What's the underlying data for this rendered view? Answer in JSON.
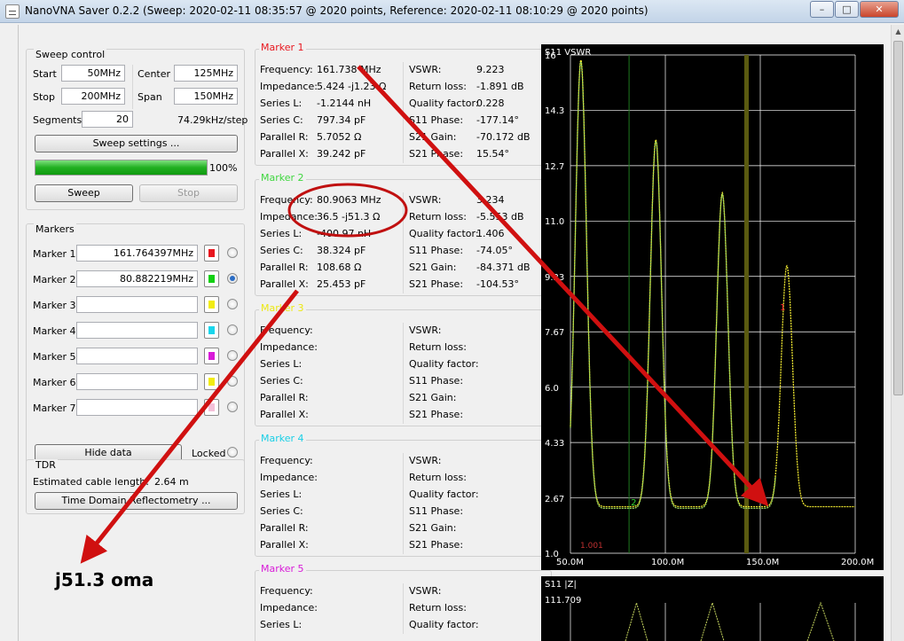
{
  "window": {
    "title": "NanoVNA Saver 0.2.2 (Sweep: 2020-02-11 08:35:57 @ 2020 points, Reference: 2020-02-11 08:10:29 @ 2020 points)",
    "minimize_glyph": "–",
    "maximize_glyph": "□",
    "close_glyph": "✕"
  },
  "sweep_control": {
    "title": "Sweep control",
    "start_label": "Start",
    "start_value": "50MHz",
    "center_label": "Center",
    "center_value": "125MHz",
    "stop_label": "Stop",
    "stop_value": "200MHz",
    "span_label": "Span",
    "span_value": "150MHz",
    "segments_label": "Segments",
    "segments_value": "20",
    "step": "74.29kHz/step",
    "settings_button": "Sweep settings ...",
    "progress": 1.0,
    "progress_text": "100%",
    "sweep_button": "Sweep",
    "stop_button": "Stop"
  },
  "markers_panel": {
    "title": "Markers",
    "items": [
      {
        "label": "Marker 1",
        "value": "161.764397MHz",
        "color": "#e8161e",
        "selected": false
      },
      {
        "label": "Marker 2",
        "value": "80.882219MHz",
        "color": "#12d012",
        "selected": true
      },
      {
        "label": "Marker 3",
        "value": "",
        "color": "#f2ec12",
        "selected": false
      },
      {
        "label": "Marker 4",
        "value": "",
        "color": "#1ad6ec",
        "selected": false
      },
      {
        "label": "Marker 5",
        "value": "",
        "color": "#d81ad8",
        "selected": false
      },
      {
        "label": "Marker 6",
        "value": "",
        "color": "#f2ec12",
        "selected": false
      },
      {
        "label": "Marker 7",
        "value": "",
        "color": "#f4c0d8",
        "selected": false
      }
    ],
    "hide_button": "Hide data",
    "locked_label": "Locked"
  },
  "tdr": {
    "title": "TDR",
    "cable_length_label": "Estimated cable length:",
    "cable_length_value": "2.64 m",
    "button": "Time Domain Reflectometry ..."
  },
  "marker_info": [
    {
      "title": "Marker 1",
      "color": "#e8161e",
      "left": [
        [
          "Frequency:",
          "161.738 MHz"
        ],
        [
          "Impedance:",
          "5.424 -j1.23 Ω"
        ],
        [
          "Series L:",
          "-1.2144 nH"
        ],
        [
          "Series C:",
          "797.34 pF"
        ],
        [
          "Parallel R:",
          "5.7052 Ω"
        ],
        [
          "Parallel X:",
          "39.242 pF"
        ]
      ],
      "right": [
        [
          "VSWR:",
          "9.223"
        ],
        [
          "Return loss:",
          "-1.891 dB"
        ],
        [
          "Quality factor:",
          "0.228"
        ],
        [
          "S11 Phase:",
          "-177.14°"
        ],
        [
          "S21 Gain:",
          "-70.172 dB"
        ],
        [
          "S21 Phase:",
          "15.54°"
        ]
      ]
    },
    {
      "title": "Marker 2",
      "color": "#3ed63e",
      "left": [
        [
          "Frequency:",
          "80.9063 MHz"
        ],
        [
          "Impedance:",
          "36.5 -j51.3 Ω"
        ],
        [
          "Series L:",
          "-400.97 nH"
        ],
        [
          "Series C:",
          "38.324 pF"
        ],
        [
          "Parallel R:",
          "108.68 Ω"
        ],
        [
          "Parallel X:",
          "25.453 pF"
        ]
      ],
      "right": [
        [
          "VSWR:",
          "3.234"
        ],
        [
          "Return loss:",
          "-5.553 dB"
        ],
        [
          "Quality factor:",
          "1.406"
        ],
        [
          "S11 Phase:",
          "-74.05°"
        ],
        [
          "S21 Gain:",
          "-84.371 dB"
        ],
        [
          "S21 Phase:",
          "-104.53°"
        ]
      ]
    },
    {
      "title": "Marker 3",
      "color": "#ece812",
      "left": [
        [
          "Frequency:",
          ""
        ],
        [
          "Impedance:",
          ""
        ],
        [
          "Series L:",
          ""
        ],
        [
          "Series C:",
          ""
        ],
        [
          "Parallel R:",
          ""
        ],
        [
          "Parallel X:",
          ""
        ]
      ],
      "right": [
        [
          "VSWR:",
          ""
        ],
        [
          "Return loss:",
          ""
        ],
        [
          "Quality factor:",
          ""
        ],
        [
          "S11 Phase:",
          ""
        ],
        [
          "S21 Gain:",
          ""
        ],
        [
          "S21 Phase:",
          ""
        ]
      ]
    },
    {
      "title": "Marker 4",
      "color": "#19cfe6",
      "left": [
        [
          "Frequency:",
          ""
        ],
        [
          "Impedance:",
          ""
        ],
        [
          "Series L:",
          ""
        ],
        [
          "Series C:",
          ""
        ],
        [
          "Parallel R:",
          ""
        ],
        [
          "Parallel X:",
          ""
        ]
      ],
      "right": [
        [
          "VSWR:",
          ""
        ],
        [
          "Return loss:",
          ""
        ],
        [
          "Quality factor:",
          ""
        ],
        [
          "S11 Phase:",
          ""
        ],
        [
          "S21 Gain:",
          ""
        ],
        [
          "S21 Phase:",
          ""
        ]
      ]
    },
    {
      "title": "Marker 5",
      "color": "#d81ad8",
      "left": [
        [
          "Frequency:",
          ""
        ],
        [
          "Impedance:",
          ""
        ],
        [
          "Series L:",
          ""
        ]
      ],
      "right": [
        [
          "VSWR:",
          ""
        ],
        [
          "Return loss:",
          ""
        ],
        [
          "Quality factor:",
          ""
        ]
      ]
    }
  ],
  "vswr_chart": {
    "title": "S11 VSWR",
    "y_ticks": [
      "16",
      "14.3",
      "12.7",
      "11.0",
      "9.33",
      "7.67",
      "6.0",
      "4.33",
      "2.67",
      "1.0"
    ],
    "x_ticks": [
      "50.0M",
      "100.0M",
      "150.0M",
      "200.0M"
    ],
    "corner_note": "1.001",
    "marker_2_tag": "2",
    "marker_1_tag": "1",
    "colors": {
      "trace": "#9cd860",
      "reference": "#f0e830",
      "marker1": "#ff3030",
      "marker2": "#30d030",
      "grid": "#ffffff"
    }
  },
  "z_chart": {
    "title": "S11 |Z|",
    "top_value": "111.709"
  },
  "annotation": {
    "text": "j51.3 oma",
    "color": "#d01010"
  }
}
